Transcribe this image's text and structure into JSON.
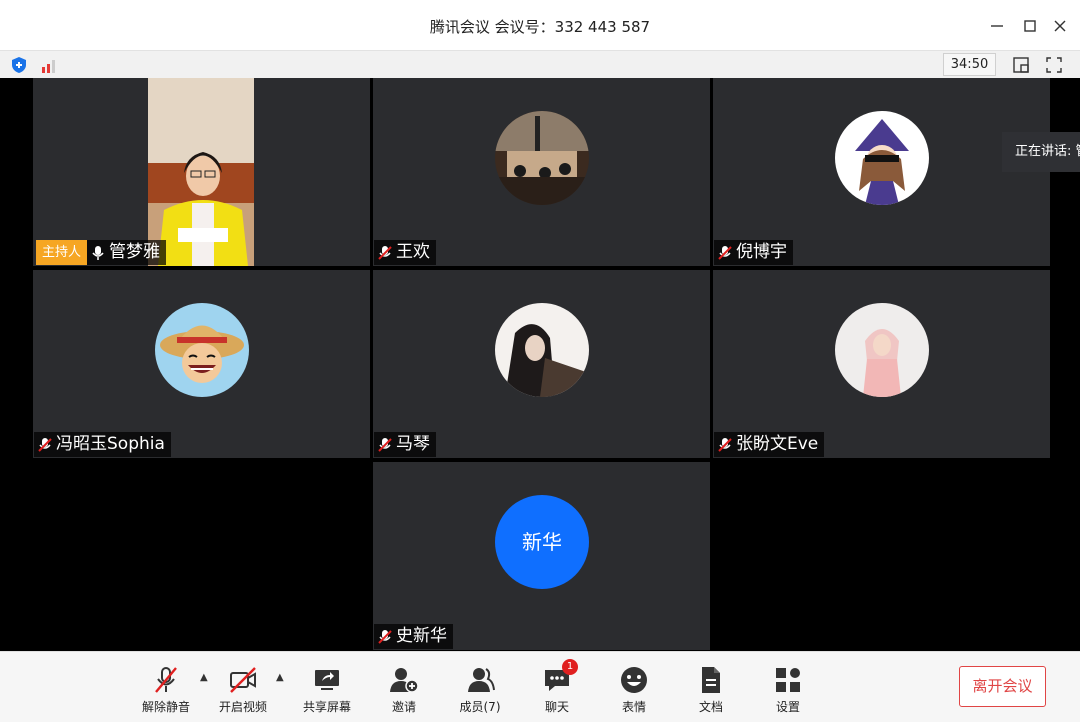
{
  "window": {
    "title": "腾讯会议 会议号：332 443 587",
    "minimize_icon": "minimize-icon",
    "maximize_icon": "maximize-icon",
    "close_icon": "close-icon"
  },
  "statusbar": {
    "timer": "34:50",
    "icons": [
      "shield-icon",
      "signal-icon",
      "layout-icon",
      "fullscreen-icon"
    ]
  },
  "participants": [
    {
      "name": "管梦雅",
      "host_badge": "主持人",
      "muted": false,
      "video_on": true
    },
    {
      "name": "王欢",
      "muted": true
    },
    {
      "name": "倪博宇",
      "muted": true
    },
    {
      "name": "冯昭玉Sophia",
      "muted": true
    },
    {
      "name": "马琴",
      "muted": true
    },
    {
      "name": "张盼文Eve",
      "muted": true
    },
    {
      "name": "史新华",
      "muted": true,
      "avatar_text": "新华",
      "avatar_color": "#0f6fff"
    }
  ],
  "speaking": "正在讲话: 管",
  "toolbar": {
    "unmute": "解除静音",
    "start_video": "开启视频",
    "share_screen": "共享屏幕",
    "invite": "邀请",
    "members": "成员(7)",
    "chat": "聊天",
    "chat_badge": "1",
    "reactions": "表情",
    "docs": "文档",
    "settings": "设置",
    "leave": "离开会议"
  },
  "colors": {
    "tile_bg": "#2b2c2f",
    "stage_bg": "#000000",
    "host_badge": "#f6a623",
    "accent_blue": "#0f6fff",
    "leave_red": "#e04545",
    "muted_red": "#e02020"
  }
}
